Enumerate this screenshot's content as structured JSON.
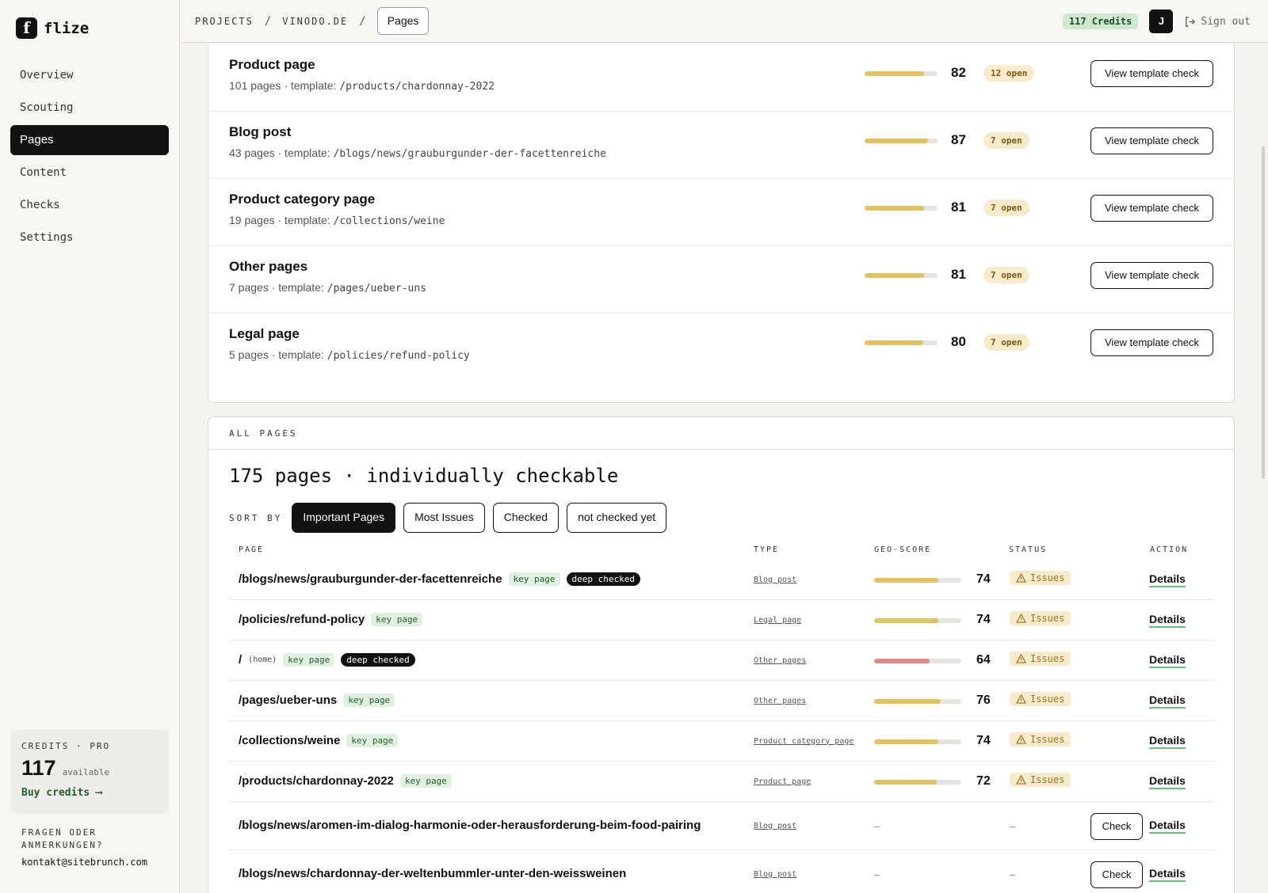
{
  "app": {
    "name": "flize",
    "logo_letter": "f"
  },
  "sidebar": {
    "items": [
      {
        "label": "Overview",
        "active": false
      },
      {
        "label": "Scouting",
        "active": false
      },
      {
        "label": "Pages",
        "active": true
      },
      {
        "label": "Content",
        "active": false
      },
      {
        "label": "Checks",
        "active": false
      },
      {
        "label": "Settings",
        "active": false
      }
    ],
    "credits": {
      "label": "CREDITS · PRO",
      "amount": "117",
      "available": "available",
      "buy": "Buy credits ⟶"
    },
    "contact": {
      "question": "FRAGEN ODER ANMERKUNGEN?",
      "email": "kontakt@sitebrunch.com"
    }
  },
  "topbar": {
    "breadcrumb": [
      "PROJECTS",
      "VINODO.DE"
    ],
    "separator": "/",
    "current": "Pages",
    "credits_pill": "117 Credits",
    "avatar": "J",
    "signout": "Sign out"
  },
  "templates": {
    "button_label": "View template check",
    "rows": [
      {
        "title": "Product page",
        "count": "101 pages · template:",
        "path": "/products/chardonnay-2022",
        "score": "82",
        "score_value": 82,
        "open": "12 open"
      },
      {
        "title": "Blog post",
        "count": "43 pages · template:",
        "path": "/blogs/news/grauburgunder-der-facettenreiche",
        "score": "87",
        "score_value": 87,
        "open": "7 open"
      },
      {
        "title": "Product category page",
        "count": "19 pages · template:",
        "path": "/collections/weine",
        "score": "81",
        "score_value": 81,
        "open": "7 open"
      },
      {
        "title": "Other pages",
        "count": "7 pages · template:",
        "path": "/pages/ueber-uns",
        "score": "81",
        "score_value": 81,
        "open": "7 open"
      },
      {
        "title": "Legal page",
        "count": "5 pages · template:",
        "path": "/policies/refund-policy",
        "score": "80",
        "score_value": 80,
        "open": "7 open"
      }
    ]
  },
  "all_pages": {
    "section_label": "ALL PAGES",
    "title": "175 pages · individually checkable",
    "sort_label": "SORT BY",
    "sort_options": [
      {
        "label": "Important Pages",
        "active": true
      },
      {
        "label": "Most Issues",
        "active": false
      },
      {
        "label": "Checked",
        "active": false
      },
      {
        "label": "not checked yet",
        "active": false
      }
    ],
    "columns": {
      "page": "PAGE",
      "type": "TYPE",
      "geo": "GEO-SCORE",
      "status": "STATUS",
      "action": "ACTION"
    },
    "tag_key": "key page",
    "tag_deep": "deep checked",
    "home_note": "(home)",
    "issues_label": "Issues",
    "details_label": "Details",
    "check_label": "Check",
    "dash": "–",
    "rows": [
      {
        "path": "/blogs/news/grauburgunder-der-facettenreiche",
        "key": true,
        "deep": true,
        "home": false,
        "type": "Blog post",
        "score": "74",
        "score_value": 74,
        "bar_color": "#e2c25f",
        "status": "issues"
      },
      {
        "path": "/policies/refund-policy",
        "key": true,
        "deep": false,
        "home": false,
        "type": "Legal page",
        "score": "74",
        "score_value": 74,
        "bar_color": "#e2c25f",
        "status": "issues"
      },
      {
        "path": "/",
        "key": true,
        "deep": true,
        "home": true,
        "type": "Other pages",
        "score": "64",
        "score_value": 64,
        "bar_color": "#e08a84",
        "status": "issues"
      },
      {
        "path": "/pages/ueber-uns",
        "key": true,
        "deep": false,
        "home": false,
        "type": "Other pages",
        "score": "76",
        "score_value": 76,
        "bar_color": "#e2c25f",
        "status": "issues"
      },
      {
        "path": "/collections/weine",
        "key": true,
        "deep": false,
        "home": false,
        "type": "Product category page",
        "score": "74",
        "score_value": 74,
        "bar_color": "#e2c25f",
        "status": "issues"
      },
      {
        "path": "/products/chardonnay-2022",
        "key": true,
        "deep": false,
        "home": false,
        "type": "Product page",
        "score": "72",
        "score_value": 72,
        "bar_color": "#e2c25f",
        "status": "issues"
      },
      {
        "path": "/blogs/news/aromen-im-dialog-harmonie-oder-herausforderung-beim-food-pairing",
        "key": false,
        "deep": false,
        "home": false,
        "type": "Blog post",
        "score": "",
        "score_value": null,
        "bar_color": "",
        "status": "unchecked"
      },
      {
        "path": "/blogs/news/chardonnay-der-weltenbummler-unter-den-weissweinen",
        "key": false,
        "deep": false,
        "home": false,
        "type": "Blog post",
        "score": "",
        "score_value": null,
        "bar_color": "",
        "status": "unchecked"
      }
    ]
  },
  "colors": {
    "template_bar": "#e2c25f",
    "accent_green": "#6cbf7c",
    "badge_bg": "#f8ebcb"
  }
}
